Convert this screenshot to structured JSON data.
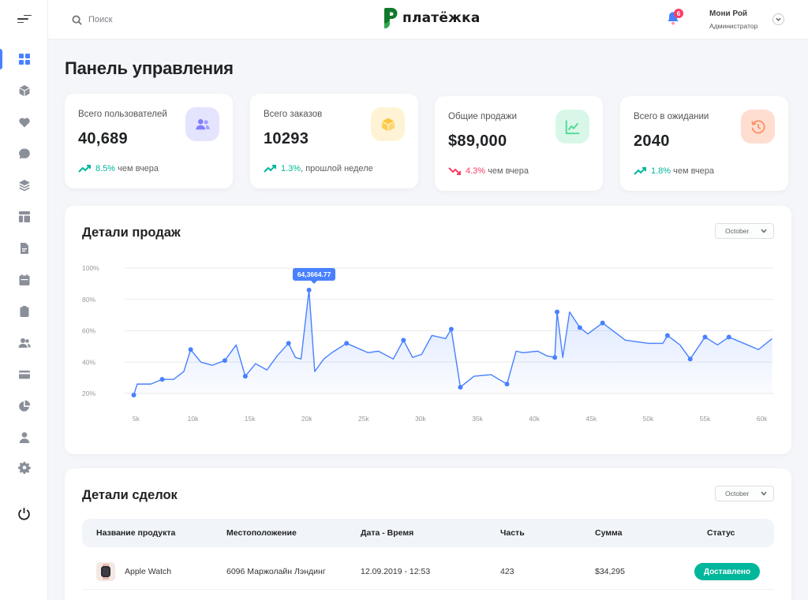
{
  "header": {
    "search_placeholder": "Поиск",
    "logo_text": "платёжка",
    "notifications_count": "6",
    "user_name": "Мони Рой",
    "user_role": "Администратор"
  },
  "sidebar": {
    "items": [
      {
        "icon": "dashboard-icon",
        "active": true
      },
      {
        "icon": "box-icon"
      },
      {
        "icon": "heart-icon"
      },
      {
        "icon": "chat-icon"
      },
      {
        "icon": "layers-icon"
      },
      {
        "icon": "layout-icon"
      },
      {
        "icon": "document-icon"
      },
      {
        "icon": "calendar-icon"
      },
      {
        "icon": "clipboard-icon"
      },
      {
        "icon": "team-icon"
      },
      {
        "icon": "card-icon"
      },
      {
        "icon": "pie-chart-icon"
      },
      {
        "icon": "user-icon"
      },
      {
        "icon": "settings-icon"
      },
      {
        "icon": "power-icon"
      }
    ]
  },
  "page_title": "Панель управления",
  "stats": [
    {
      "label": "Всего пользователей",
      "value": "40,689",
      "trend_value": "8.5%",
      "trend_text": " чем вчера",
      "trend": "up",
      "icon": "users-icon",
      "color": "#8280ff"
    },
    {
      "label": "Всего заказов",
      "value": "10293",
      "trend_value": "1.3%",
      "trend_text": ", прошлой неделе",
      "trend": "up",
      "icon": "cube-icon",
      "color": "#fec53d"
    },
    {
      "label": "Общие продажи",
      "value": "$89,000",
      "trend_value": "4.3%",
      "trend_text": " чем вчера",
      "trend": "down",
      "icon": "line-chart-icon",
      "color": "#4ad991"
    },
    {
      "label": "Всего в ожидании",
      "value": "2040",
      "trend_value": "1.8%",
      "trend_text": " чем вчера",
      "trend": "up",
      "icon": "history-icon",
      "color": "#ff9066"
    }
  ],
  "sales": {
    "title": "Детали продаж",
    "month": "October",
    "tooltip": "64,3664.77"
  },
  "chart_data": {
    "type": "area",
    "title": "Детали продаж",
    "xlabel": "",
    "ylabel": "",
    "x_ticks": [
      "5k",
      "10k",
      "15k",
      "20k",
      "25k",
      "30k",
      "35k",
      "40k",
      "45k",
      "50k",
      "55k",
      "60k"
    ],
    "y_ticks": [
      "20%",
      "40%",
      "60%",
      "80%",
      "100%"
    ],
    "xlim": [
      4000,
      61000
    ],
    "ylim": [
      15,
      100
    ],
    "grid": true,
    "color": "#4880ff",
    "series": [
      {
        "x": [
          4800,
          5100,
          6300,
          7300,
          8300,
          9200,
          9800,
          10700,
          11700,
          12800,
          13800,
          14600,
          15500,
          16500,
          17400,
          18400,
          19000,
          19500,
          20200,
          20700,
          21500,
          22200,
          23500,
          25400,
          26300,
          27600,
          28500,
          29300,
          30100,
          31000,
          32200,
          32700,
          33500,
          34700,
          36200,
          37600,
          38400,
          39000,
          40300,
          41100,
          41800,
          42000,
          42500,
          43100,
          44000,
          44700,
          46000,
          48000,
          50000,
          51300,
          51700,
          52800,
          53700,
          55000,
          56100,
          57100,
          58400,
          59700,
          60900
        ],
        "y": [
          19,
          26,
          26,
          29,
          29,
          34,
          48,
          40,
          38,
          41,
          51,
          31,
          39,
          35,
          44,
          52,
          43,
          42,
          86,
          34,
          42,
          46,
          52,
          46,
          47,
          42,
          54,
          43,
          45,
          57,
          55,
          61,
          24,
          31,
          32,
          26,
          47,
          46,
          47,
          44,
          43,
          72,
          43,
          72,
          62,
          58,
          65,
          54,
          52,
          52,
          57,
          51,
          42,
          56,
          51,
          56,
          52,
          48,
          55
        ]
      }
    ],
    "highlight": {
      "x": 20700,
      "y": 86,
      "label": "64,3664.77"
    }
  },
  "deals": {
    "title": "Детали сделок",
    "month": "October",
    "columns": [
      "Название продукта",
      "Местоположение",
      "Дата - Время",
      "Часть",
      "Сумма",
      "Статус"
    ],
    "rows": [
      {
        "product": "Apple Watch",
        "location": "6096 Маржолайн Лэндинг",
        "datetime": "12.09.2019 - 12:53",
        "pieces": "423",
        "amount": "$34,295",
        "status": "Доставлено"
      }
    ]
  }
}
